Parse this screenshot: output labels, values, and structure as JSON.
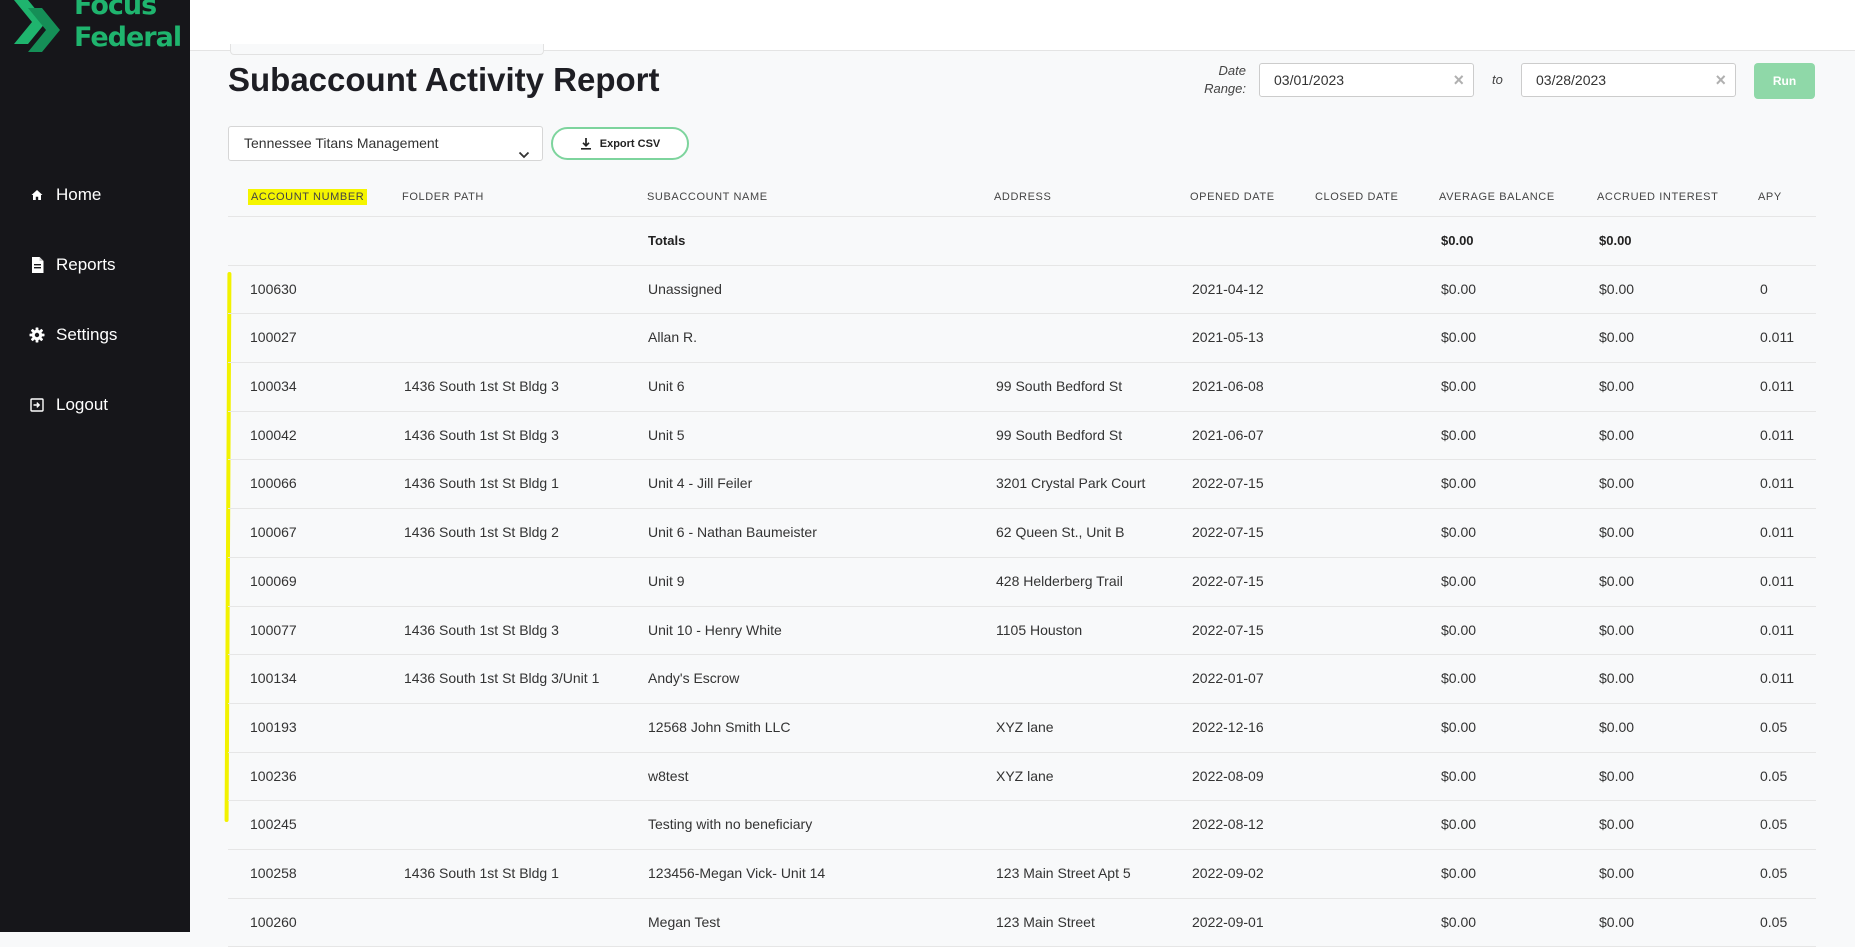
{
  "brand": {
    "line1": "Focus",
    "line2": "Federal",
    "accent": "#1fb46e"
  },
  "nav": [
    {
      "label": "Home",
      "icon": "home-icon"
    },
    {
      "label": "Reports",
      "icon": "document-icon"
    },
    {
      "label": "Settings",
      "icon": "gear-icon"
    },
    {
      "label": "Logout",
      "icon": "logout-icon"
    }
  ],
  "page": {
    "title": "Subaccount Activity Report"
  },
  "filters": {
    "date_range_label_1": "Date",
    "date_range_label_2": "Range:",
    "start_date": "03/01/2023",
    "to_label": "to",
    "end_date": "03/28/2023",
    "run_label": "Run",
    "selected_account": "Tennessee Titans Management",
    "export_label": "Export CSV"
  },
  "table": {
    "columns": [
      "ACCOUNT NUMBER",
      "FOLDER PATH",
      "SUBACCOUNT NAME",
      "ADDRESS",
      "OPENED DATE",
      "CLOSED DATE",
      "AVERAGE BALANCE",
      "ACCRUED INTEREST",
      "APY"
    ],
    "totals": {
      "label": "Totals",
      "average_balance": "$0.00",
      "accrued_interest": "$0.00"
    },
    "rows": [
      [
        "100630",
        "",
        "Unassigned",
        "",
        "2021-04-12",
        "",
        "$0.00",
        "$0.00",
        "0"
      ],
      [
        "100027",
        "",
        "Allan R.",
        "",
        "2021-05-13",
        "",
        "$0.00",
        "$0.00",
        "0.011"
      ],
      [
        "100034",
        "1436 South 1st St Bldg 3",
        "Unit 6",
        "99 South Bedford St",
        "2021-06-08",
        "",
        "$0.00",
        "$0.00",
        "0.011"
      ],
      [
        "100042",
        "1436 South 1st St Bldg 3",
        "Unit 5",
        "99 South Bedford St",
        "2021-06-07",
        "",
        "$0.00",
        "$0.00",
        "0.011"
      ],
      [
        "100066",
        "1436 South 1st St Bldg 1",
        "Unit 4 - Jill Feiler",
        "3201 Crystal Park Court",
        "2022-07-15",
        "",
        "$0.00",
        "$0.00",
        "0.011"
      ],
      [
        "100067",
        "1436 South 1st St Bldg 2",
        "Unit 6 - Nathan Baumeister",
        "62 Queen St., Unit B",
        "2022-07-15",
        "",
        "$0.00",
        "$0.00",
        "0.011"
      ],
      [
        "100069",
        "",
        "Unit 9",
        "428 Helderberg Trail",
        "2022-07-15",
        "",
        "$0.00",
        "$0.00",
        "0.011"
      ],
      [
        "100077",
        "1436 South 1st St Bldg 3",
        "Unit 10 - Henry White",
        "1105 Houston",
        "2022-07-15",
        "",
        "$0.00",
        "$0.00",
        "0.011"
      ],
      [
        "100134",
        "1436 South 1st St Bldg 3/Unit 1",
        "Andy's Escrow",
        "",
        "2022-01-07",
        "",
        "$0.00",
        "$0.00",
        "0.011"
      ],
      [
        "100193",
        "",
        "12568 John Smith LLC",
        "XYZ lane",
        "2022-12-16",
        "",
        "$0.00",
        "$0.00",
        "0.05"
      ],
      [
        "100236",
        "",
        "w8test",
        "XYZ lane",
        "2022-08-09",
        "",
        "$0.00",
        "$0.00",
        "0.05"
      ],
      [
        "100245",
        "",
        "Testing with no beneficiary",
        "",
        "2022-08-12",
        "",
        "$0.00",
        "$0.00",
        "0.05"
      ],
      [
        "100258",
        "1436 South 1st St Bldg 1",
        "123456-Megan Vick- Unit 14",
        "123 Main Street Apt 5",
        "2022-09-02",
        "",
        "$0.00",
        "$0.00",
        "0.05"
      ],
      [
        "100260",
        "",
        "Megan Test",
        "123 Main Street",
        "2022-09-01",
        "",
        "$0.00",
        "$0.00",
        "0.05"
      ]
    ]
  },
  "highlight_color": "#f5f500"
}
